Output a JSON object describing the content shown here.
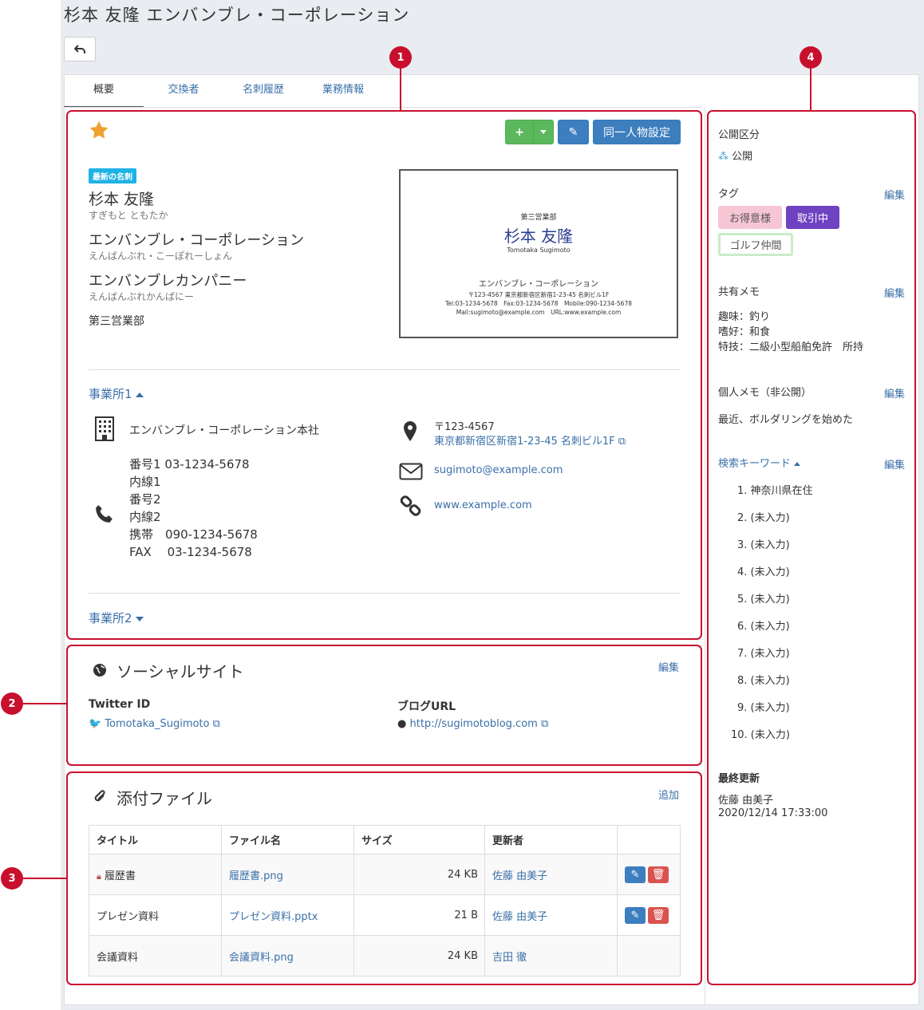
{
  "page": {
    "title": "杉本 友隆 エンバンブレ・コーポレーション"
  },
  "tabs": [
    "概要",
    "交換者",
    "名刺履歴",
    "業務情報"
  ],
  "callouts": [
    "1",
    "2",
    "3",
    "4"
  ],
  "actions": {
    "add": "+",
    "edit": "✎",
    "same_person": "同一人物設定"
  },
  "card": {
    "badge": "最新の名刺",
    "name": "杉本 友隆",
    "name_kana": "すぎもと ともたか",
    "company": "エンバンブレ・コーポレーション",
    "company_kana": "えんばんぶれ・こーぽれーしょん",
    "company2": "エンバンブレカンパニー",
    "company2_kana": "えんばんぶれかんぱにー",
    "department": "第三営業部",
    "image": {
      "dept": "第三営業部",
      "name": "杉本 友隆",
      "romaji": "Tomotaka Sugimoto",
      "company": "エンバンブレ・コーポレーション",
      "address": "〒123-4567 東京都新宿区新宿1-23-45 名刺ビル1F",
      "tel": "Tel:03-1234-5678　Fax:03-1234-5678　Mobile:090-1234-5678",
      "mail": "Mail:sugimoto@example.com　URL:www.example.com"
    }
  },
  "office1": {
    "title": "事業所1",
    "name": "エンバンブレ・コーポレーション本社",
    "phones": [
      {
        "k": "番号1",
        "v": "03-1234-5678"
      },
      {
        "k": "内線1",
        "v": ""
      },
      {
        "k": "番号2",
        "v": ""
      },
      {
        "k": "内線2",
        "v": ""
      },
      {
        "k": "携帯",
        "v": "090-1234-5678"
      },
      {
        "k": "FAX",
        "v": "03-1234-5678"
      }
    ],
    "zip": "〒123-4567",
    "address": "東京都新宿区新宿1-23-45 名刺ビル1F",
    "email": "sugimoto@example.com",
    "url": "www.example.com"
  },
  "office2": {
    "title": "事業所2"
  },
  "social": {
    "title": "ソーシャルサイト",
    "edit": "編集",
    "twitter_label": "Twitter ID",
    "twitter": "Tomotaka_Sugimoto",
    "blog_label": "ブログURL",
    "blog": "http://sugimotoblog.com"
  },
  "files": {
    "title": "添付ファイル",
    "add": "追加",
    "headers": [
      "タイトル",
      "ファイル名",
      "サイズ",
      "更新者"
    ],
    "rows": [
      {
        "title": "履歴書",
        "file": "履歴書.png",
        "size": "24 KB",
        "user": "佐藤 由美子"
      },
      {
        "title": "プレゼン資料",
        "file": "プレゼン資料.pptx",
        "size": "21 B",
        "user": "佐藤 由美子"
      },
      {
        "title": "会議資料",
        "file": "会議資料.png",
        "size": "24 KB",
        "user": "吉田 徹"
      }
    ]
  },
  "sidebar": {
    "visibility_label": "公開区分",
    "visibility": "公開",
    "tag_label": "タグ",
    "edit": "編集",
    "tags": [
      "お得意様",
      "取引中",
      "ゴルフ仲間"
    ],
    "shared_memo_label": "共有メモ",
    "shared_memo": [
      "趣味：釣り",
      "嗜好：和食",
      "特技：二級小型船舶免許　所持"
    ],
    "private_memo_label": "個人メモ（非公開）",
    "private_memo": "最近、ボルダリングを始めた",
    "keyword_label": "検索キーワード",
    "keywords": [
      "1. 神奈川県在住",
      "2. (未入力)",
      "3. (未入力)",
      "4. (未入力)",
      "5. (未入力)",
      "6. (未入力)",
      "7. (未入力)",
      "8. (未入力)",
      "9. (未入力)",
      "10. (未入力)"
    ],
    "updated_label": "最終更新",
    "updated_by": "佐藤 由美子",
    "updated_at": "2020/12/14 17:33:00"
  },
  "colors": {
    "accent": "#3d7ebf",
    "callout": "#c8102e",
    "star": "#f0a030",
    "green": "#5cb85c",
    "badge": "#1fb2e6",
    "tag1": "#f7c6d5",
    "tag2": "#6f42c1",
    "tag3_border": "#a9dba9"
  }
}
